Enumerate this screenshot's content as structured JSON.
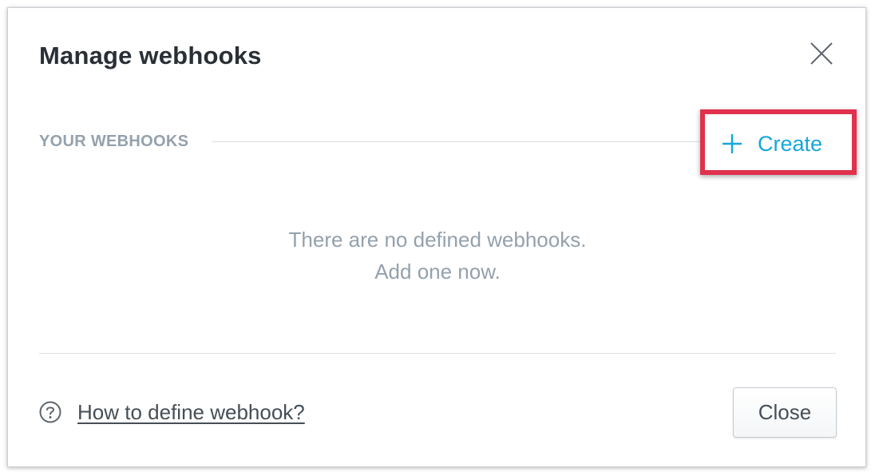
{
  "dialog": {
    "title": "Manage webhooks",
    "close_icon": "close-x-icon"
  },
  "section": {
    "label": "YOUR WEBHOOKS",
    "create_label": "Create",
    "create_icon": "plus-icon",
    "highlight_color": "#e0314d",
    "accent_color": "#14a7db"
  },
  "empty_state": {
    "line1": "There are no defined webhooks.",
    "line2": "Add one now."
  },
  "footer": {
    "help_icon": "question-circle-icon",
    "help_link": "How to define webhook?",
    "close_label": "Close"
  }
}
